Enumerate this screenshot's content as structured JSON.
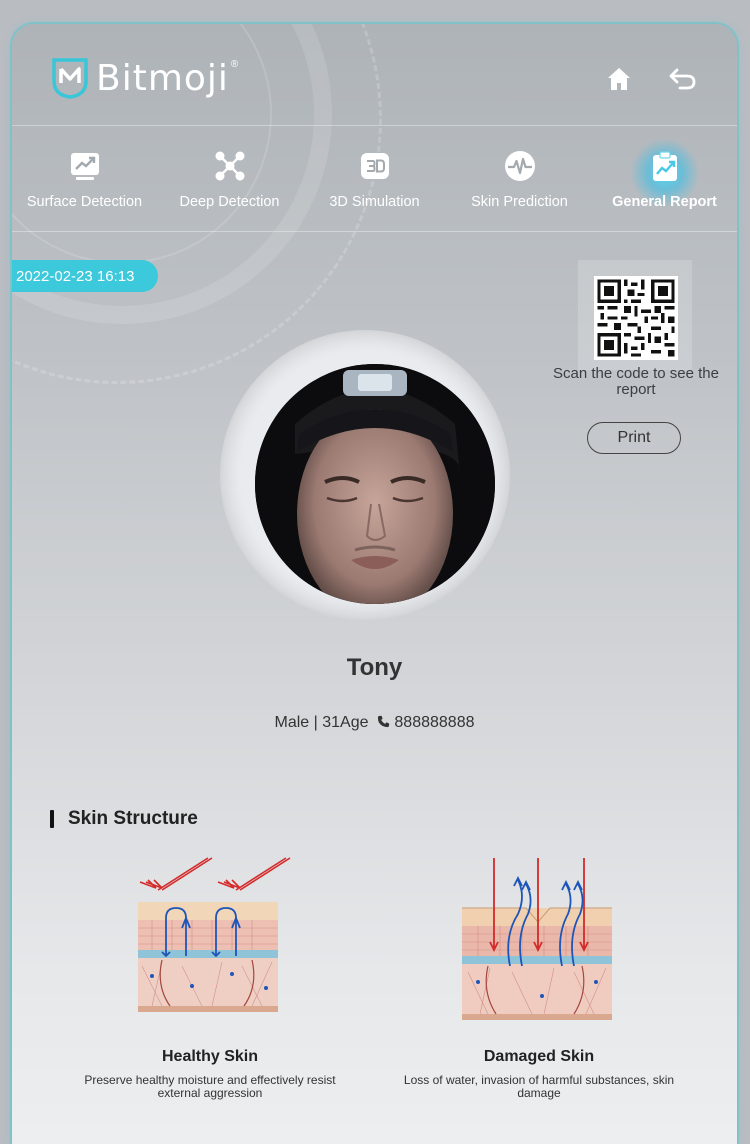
{
  "brand": {
    "name": "Bitmoji",
    "reg": "®"
  },
  "header": {
    "home_icon": "home-icon",
    "back_icon": "back-arrow-icon"
  },
  "nav": [
    {
      "label": "Surface Detection",
      "icon": "trend-chart-icon",
      "active": false
    },
    {
      "label": "Deep Detection",
      "icon": "molecule-icon",
      "active": false
    },
    {
      "label": "3D Simulation",
      "icon": "3d-icon",
      "active": false
    },
    {
      "label": "Skin Prediction",
      "icon": "pulse-icon",
      "active": false
    },
    {
      "label": "General Report",
      "icon": "clipboard-chart-icon",
      "active": true
    }
  ],
  "report": {
    "datetime": "2022-02-23 16:13",
    "scan_text": "Scan the code to see the report",
    "print_label": "Print"
  },
  "profile": {
    "name": "Tony",
    "gender": "Male",
    "age": "31Age",
    "phone": "888888888"
  },
  "skin_structure": {
    "title": "Skin Structure",
    "healthy": {
      "title": "Healthy Skin",
      "desc": "Preserve healthy moisture and effectively resist external aggression"
    },
    "damaged": {
      "title": "Damaged Skin",
      "desc": "Loss of water, invasion of harmful substances, skin damage"
    }
  },
  "colors": {
    "accent": "#3cc9dc",
    "text_dark": "#333333"
  }
}
